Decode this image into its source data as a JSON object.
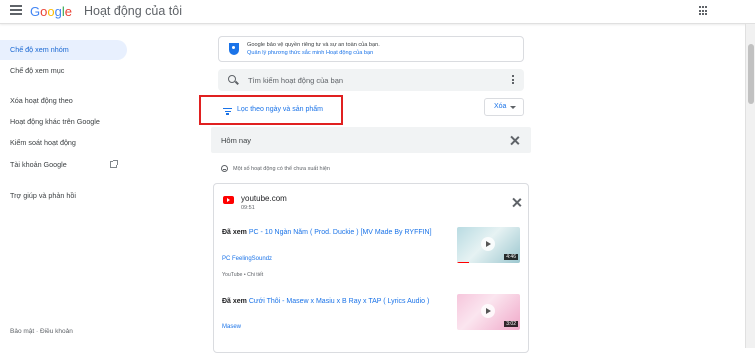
{
  "header": {
    "logo": [
      "G",
      "o",
      "o",
      "g",
      "l",
      "e"
    ],
    "app_title": "Hoạt động của tôi"
  },
  "sidebar": {
    "items": [
      {
        "label": "Chế độ xem nhóm",
        "active": true
      },
      {
        "label": "Chế độ xem mục",
        "active": false
      },
      {
        "label": "Xóa hoạt động theo",
        "active": false
      },
      {
        "label": "Hoạt động khác trên Google",
        "active": false
      },
      {
        "label": "Kiểm soát hoạt động",
        "active": false
      },
      {
        "label": "Tài khoản Google",
        "active": false
      },
      {
        "label": "Trợ giúp và phản hồi",
        "active": false
      }
    ],
    "footer": "Bảo mật · Điều khoản"
  },
  "notice": {
    "text": "Google bảo vệ quyền riêng tư và sự an toàn của bạn.",
    "link": "Quản lý phương thức sắc minh Hoạt động của bạn"
  },
  "search": {
    "placeholder": "Tìm kiếm hoạt động của bạn"
  },
  "filter": {
    "label": "Lọc theo ngày và sản phẩm"
  },
  "delete_button": {
    "label": "Xóa"
  },
  "today": {
    "title": "Hôm nay"
  },
  "hidden_note": "Một số hoạt động có thể chưa xuất hiện",
  "card": {
    "site": "youtube.com",
    "time": "09:51",
    "entries": [
      {
        "prefix": "Đã xem ",
        "title": "PC - 10 Ngàn Năm ( Prod. Duckie ) [MV Made By RYFFIN]",
        "channel": "PC FeelingSoundz",
        "meta": "YouTube • Chi tiết",
        "duration": "4:46"
      },
      {
        "prefix": "Đã xem ",
        "title": "Cưới Thôi - Masew x Masiu x B Ray x TAP ( Lyrics Audio )",
        "channel": "Masew",
        "duration": "3:02"
      }
    ]
  },
  "colors": {
    "accent": "#1a73e8",
    "highlight_box": "#e02020",
    "active_nav_bg": "#e8f0fe"
  }
}
